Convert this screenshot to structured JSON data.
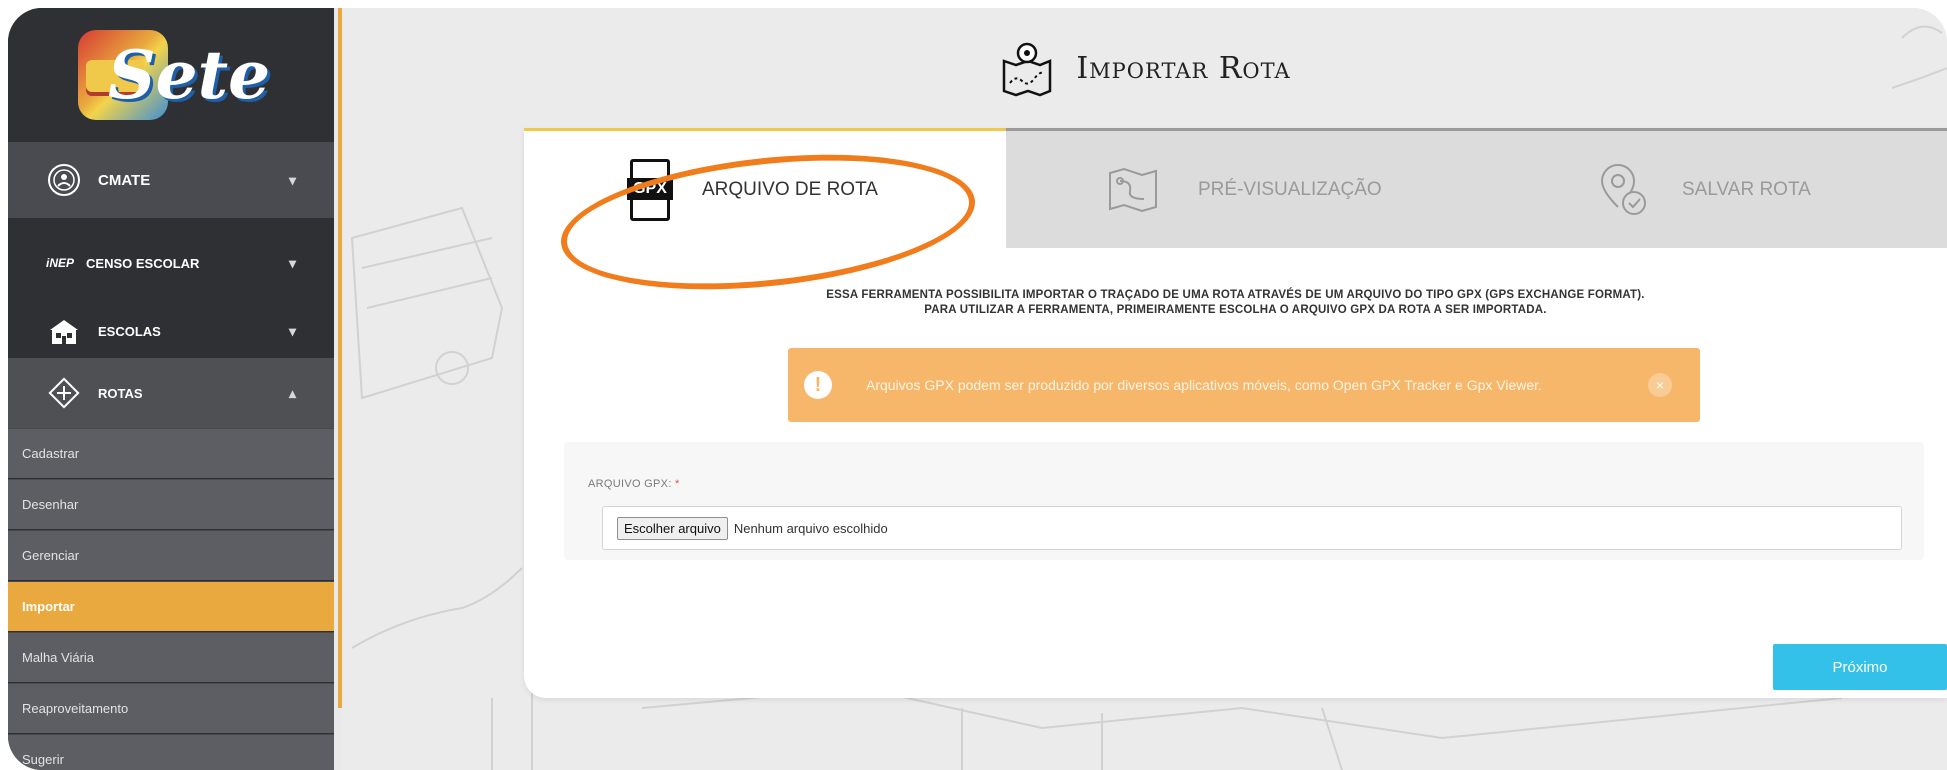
{
  "app": {
    "logo_text": "Sete"
  },
  "sidebar": {
    "user": {
      "label": "CMATE",
      "caret": "▾",
      "icon": "badge-icon"
    },
    "sections": [
      {
        "label": "CENSO ESCOLAR",
        "caret": "▾",
        "icon": "inep-icon"
      },
      {
        "label": "ESCOLAS",
        "caret": "▾",
        "icon": "school-icon"
      },
      {
        "label": "ROTAS",
        "caret": "▴",
        "icon": "route-compass-icon"
      }
    ],
    "inep_text": "iNEP",
    "subitems": [
      {
        "label": "Cadastrar",
        "active": false
      },
      {
        "label": "Desenhar",
        "active": false
      },
      {
        "label": "Gerenciar",
        "active": false
      },
      {
        "label": "Importar",
        "active": true
      },
      {
        "label": "Malha Viária",
        "active": false
      },
      {
        "label": "Reaproveitamento",
        "active": false
      },
      {
        "label": "Sugerir",
        "active": false
      }
    ]
  },
  "page": {
    "title": "Importar Rota",
    "title_icon": "map-pin-icon"
  },
  "tabs": [
    {
      "label": "ARQUIVO DE ROTA",
      "icon": "gpx-file-icon",
      "icon_text": "GPX",
      "active": true
    },
    {
      "label": "PRÉ-VISUALIZAÇÃO",
      "icon": "map-route-icon",
      "active": false
    },
    {
      "label": "SALVAR ROTA",
      "icon": "location-check-icon",
      "active": false
    }
  ],
  "description": {
    "line1": "ESSA FERRAMENTA POSSIBILITA IMPORTAR O TRAÇADO DE UMA ROTA ATRAVÉS DE UM ARQUIVO DO TIPO GPX (GPS EXCHANGE FORMAT).",
    "line2": "PARA UTILIZAR A FERRAMENTA, PRIMEIRAMENTE ESCOLHA O ARQUIVO GPX DA ROTA A SER IMPORTADA."
  },
  "alert": {
    "icon_text": "!",
    "text": "Arquivos GPX podem ser produzido por diversos aplicativos móveis, como Open GPX Tracker e Gpx Viewer.",
    "close": "×"
  },
  "form": {
    "label": "ARQUIVO GPX:",
    "required_mark": "*",
    "file_button": "Escolher arquivo",
    "file_status": "Nenhum arquivo escolhido"
  },
  "actions": {
    "next_label": "Próximo"
  },
  "colors": {
    "sidebar_bg": "#2f3034",
    "active_item": "#e9a93f",
    "alert_bg": "#f6b76b",
    "next_button": "#33c1ea",
    "highlight": "#f07c1c"
  }
}
